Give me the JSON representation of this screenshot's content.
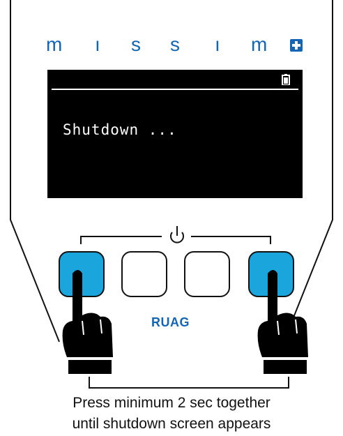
{
  "brand": {
    "letters": [
      "m",
      "ı",
      "s",
      "s",
      "ı",
      "m"
    ],
    "plus_icon": "medical-plus-icon",
    "color": "#1466b4"
  },
  "screen": {
    "message": "Shutdown ...",
    "battery_icon": "battery-icon"
  },
  "power_icon": "power-icon",
  "buttons": [
    {
      "state": "pressed",
      "color": "#1aa6dc"
    },
    {
      "state": "idle",
      "color": "#ffffff"
    },
    {
      "state": "idle",
      "color": "#ffffff"
    },
    {
      "state": "pressed",
      "color": "#1aa6dc"
    }
  ],
  "logo": "RUAG",
  "caption": {
    "line1": "Press minimum 2 sec together",
    "line2": "until shutdown screen appears"
  },
  "hand_icon": "pointing-hand-icon"
}
